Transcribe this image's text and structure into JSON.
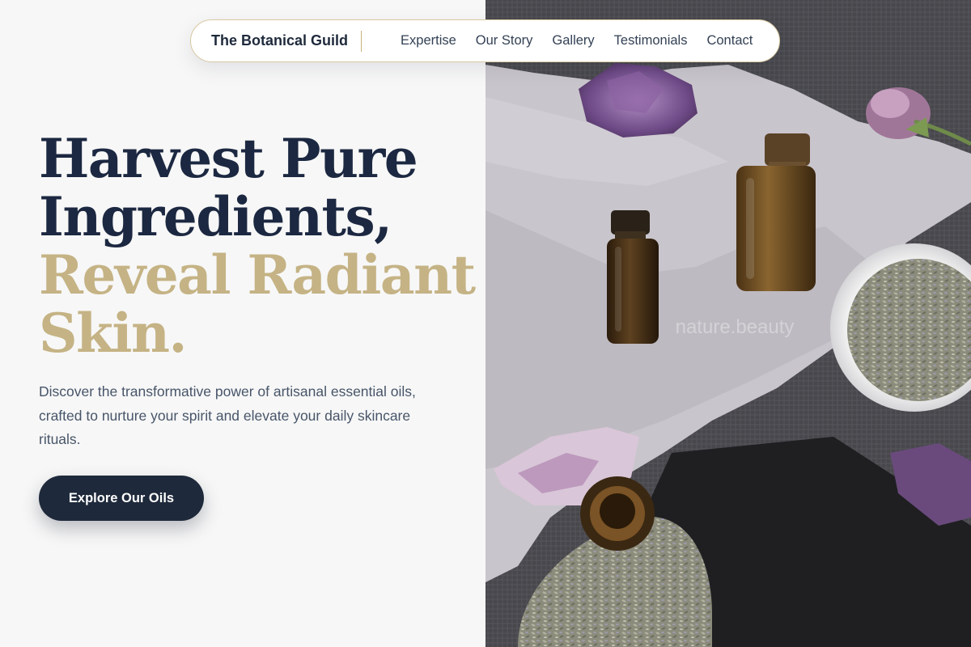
{
  "nav": {
    "brand": "The Botanical Guild",
    "links": [
      "Expertise",
      "Our Story",
      "Gallery",
      "Testimonials",
      "Contact"
    ]
  },
  "hero": {
    "headline_lines": [
      "Harvest Pure",
      "Ingredients,",
      "Reveal Radiant",
      "Skin."
    ],
    "subcopy": "Discover the transformative power of artisanal essential oils, crafted to nurture your spirit and elevate your daily skincare rituals.",
    "cta_label": "Explore Our Oils",
    "image_watermark": "nature.beauty"
  },
  "colors": {
    "page_background": "#f7f7f7",
    "navy": "#1e293b",
    "gold": "#c5b385",
    "body_text": "#475569",
    "nav_border": "#d8c9a3"
  }
}
